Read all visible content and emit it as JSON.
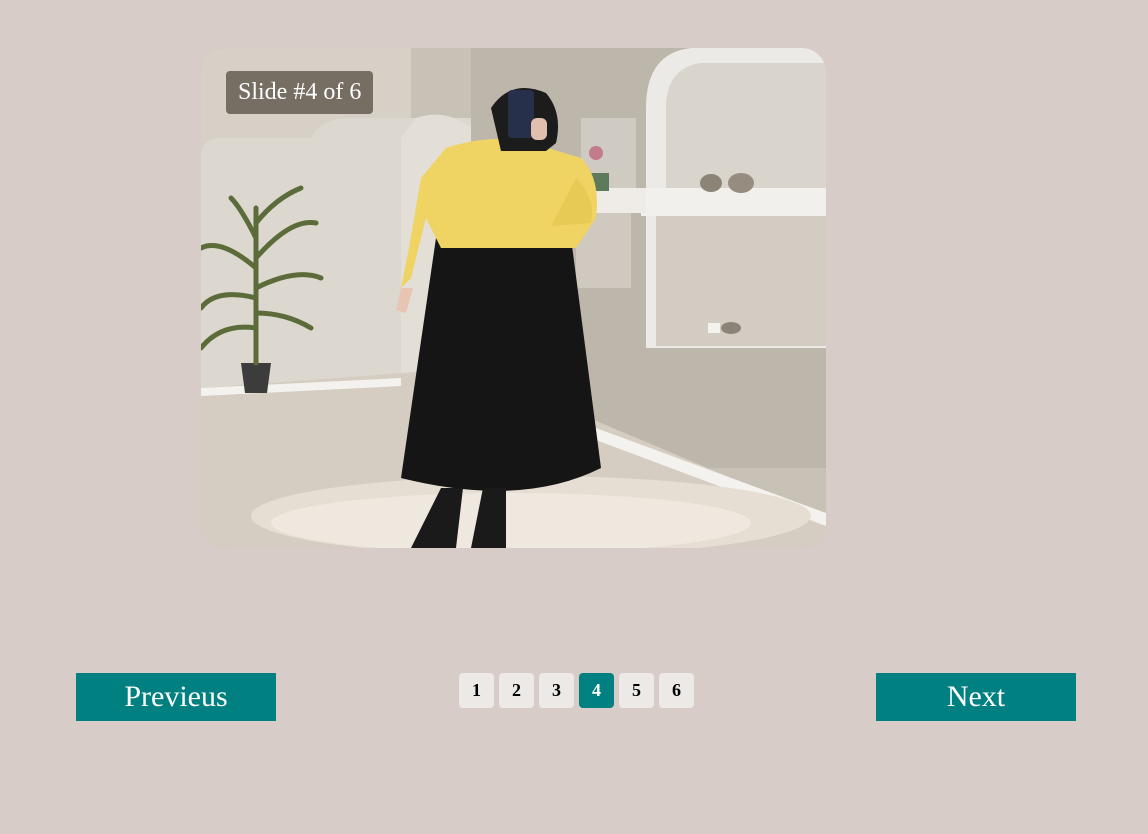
{
  "slider": {
    "counter_text": "Slide #4 of 6",
    "current": 4,
    "total": 6
  },
  "navigation": {
    "prev_label": "Previeus",
    "next_label": "Next"
  },
  "pagination": {
    "pages": [
      "1",
      "2",
      "3",
      "4",
      "5",
      "6"
    ],
    "active_page": "4"
  },
  "colors": {
    "page_background": "#d8ccc8",
    "accent": "#008080",
    "inactive_page": "#ece9e7"
  }
}
